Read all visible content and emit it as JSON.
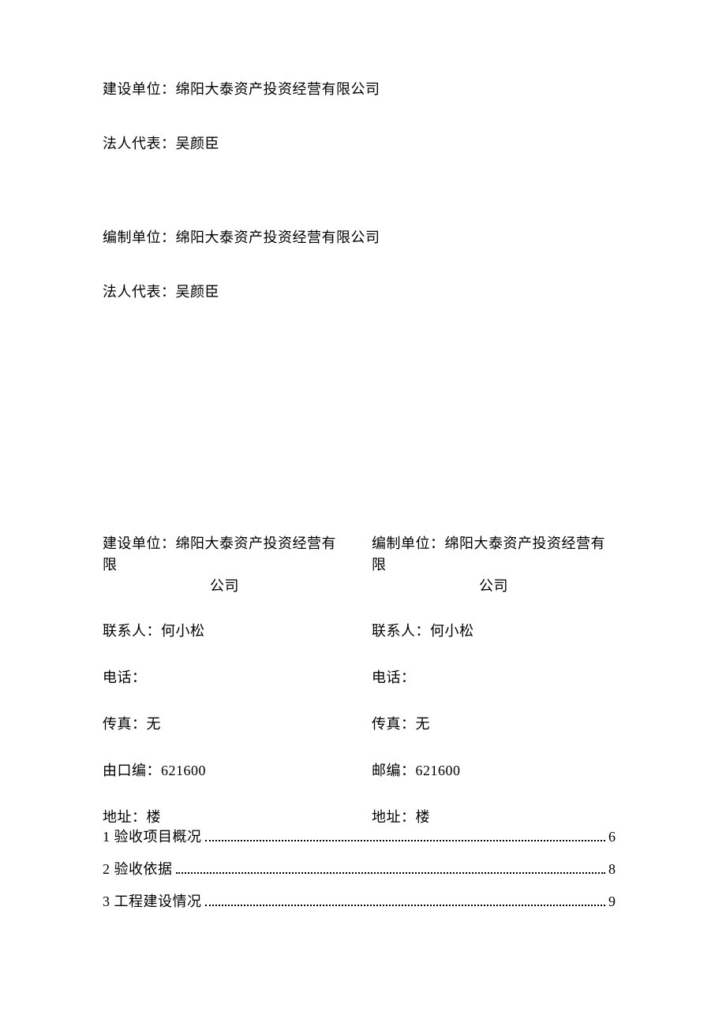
{
  "top": {
    "construction_unit": "建设单位：绵阳大泰资产投资经营有限公司",
    "legal_rep_1": "法人代表：吴颜臣",
    "compiling_unit": "编制单位：绵阳大泰资产投资经营有限公司",
    "legal_rep_2": "法人代表：吴颜臣"
  },
  "left": {
    "header_main": "建设单位：绵阳大泰资产投资经营有限",
    "header_sub": "公司",
    "contact": "联系人：何小松",
    "phone": "电话：",
    "fax": "传真：无",
    "postcode": "由口编：621600",
    "address": "地址：楼"
  },
  "right": {
    "header_main": "编制单位：绵阳大泰资产投资经营有限",
    "header_sub": "公司",
    "contact": "联系人：何小松",
    "phone": "电话：",
    "fax": "传真：无",
    "postcode": "邮编：621600",
    "address": "地址：楼"
  },
  "toc": [
    {
      "label": "1 验收项目概况",
      "page": "6"
    },
    {
      "label": "2 验收依据",
      "page": "8"
    },
    {
      "label": "3 工程建设情况",
      "page": "9"
    }
  ]
}
